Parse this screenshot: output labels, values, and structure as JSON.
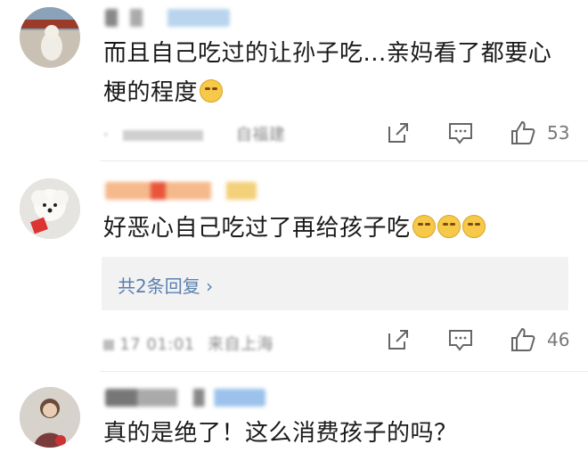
{
  "comments": [
    {
      "text": "而且自己吃过的让孙子吃...亲妈看了都要心梗的程度",
      "meta_prefix": "·",
      "meta_location": "自福建",
      "likes": "53"
    },
    {
      "text": "好恶心自己吃过了再给孩子吃",
      "replies_label": "共2条回复",
      "meta_time": "17 01:01",
      "meta_location": "来自上海",
      "likes": "46"
    },
    {
      "text": "真的是绝了！这么消费孩子的吗？"
    }
  ],
  "icons": {
    "share": "share-icon",
    "comment": "comment-icon",
    "like": "thumbs-up-icon"
  },
  "colors": {
    "link": "#5b7fb0",
    "reply_bg": "#f2f2f2",
    "meta": "#8a8a8a"
  }
}
